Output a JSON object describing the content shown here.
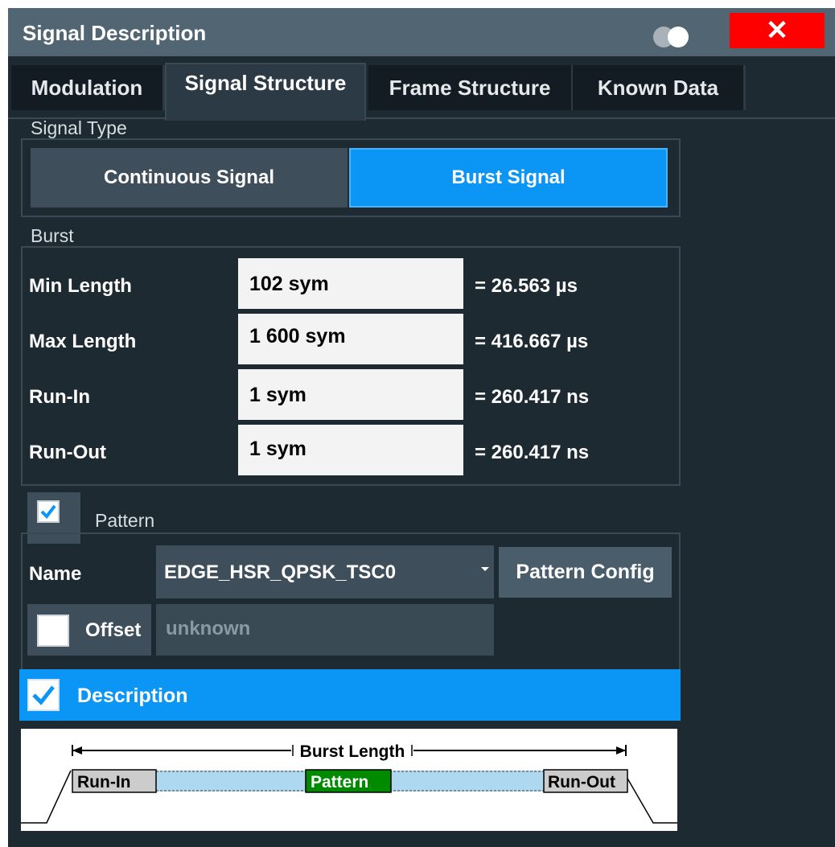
{
  "window": {
    "title": "Signal Description",
    "close_glyph": "✕"
  },
  "tabs": [
    {
      "label": "Modulation"
    },
    {
      "label": "Signal Structure"
    },
    {
      "label": "Frame Structure"
    },
    {
      "label": "Known Data"
    }
  ],
  "signal_type": {
    "section_label": "Signal Type",
    "options": [
      "Continuous Signal",
      "Burst Signal"
    ],
    "selected": "Burst Signal"
  },
  "burst": {
    "section_label": "Burst",
    "rows": [
      {
        "label": "Min Length",
        "value": "102 sym",
        "equiv": "= 26.563 µs"
      },
      {
        "label": "Max Length",
        "value": "1 600 sym",
        "equiv": "= 416.667 µs"
      },
      {
        "label": "Run-In",
        "value": "1 sym",
        "equiv": "= 260.417 ns"
      },
      {
        "label": "Run-Out",
        "value": "1 sym",
        "equiv": "= 260.417 ns"
      }
    ]
  },
  "pattern": {
    "label": "Pattern",
    "checked": true,
    "name_label": "Name",
    "name_value": "EDGE_HSR_QPSK_TSC0",
    "config_button": "Pattern Config",
    "offset_label": "Offset",
    "offset_checked": false,
    "offset_value": "unknown"
  },
  "description": {
    "label": "Description",
    "checked": true
  },
  "diagram": {
    "burst_length": "Burst Length",
    "run_in": "Run-In",
    "pattern": "Pattern",
    "run_out": "Run-Out"
  },
  "colors": {
    "accent": "#0b96f6",
    "close": "#ff0000",
    "pattern_green": "#008a00",
    "burst_fill": "#add8f0"
  }
}
